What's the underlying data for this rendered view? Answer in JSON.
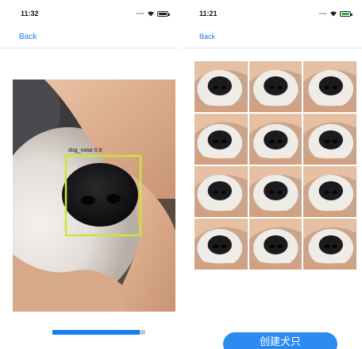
{
  "left_screen": {
    "status": {
      "time": "11:32"
    },
    "nav": {
      "back_label": "Back"
    },
    "detection": {
      "label": "dog_nose 0.9",
      "box_color": "#c8e63c"
    },
    "progress": {
      "fraction": 0.94,
      "fill_color": "#1a7cf2",
      "track_color": "#c7c7c7"
    }
  },
  "right_screen": {
    "status": {
      "time": "11:21"
    },
    "nav": {
      "back_label": "Back"
    },
    "crops": {
      "rows": 4,
      "columns": 3
    },
    "create_button": {
      "label": "创建犬只",
      "color": "#2b8bf0"
    }
  },
  "icons": [
    "signal-dots-icon",
    "wifi-icon",
    "battery-icon"
  ],
  "accent_color": "#1a7cf2"
}
